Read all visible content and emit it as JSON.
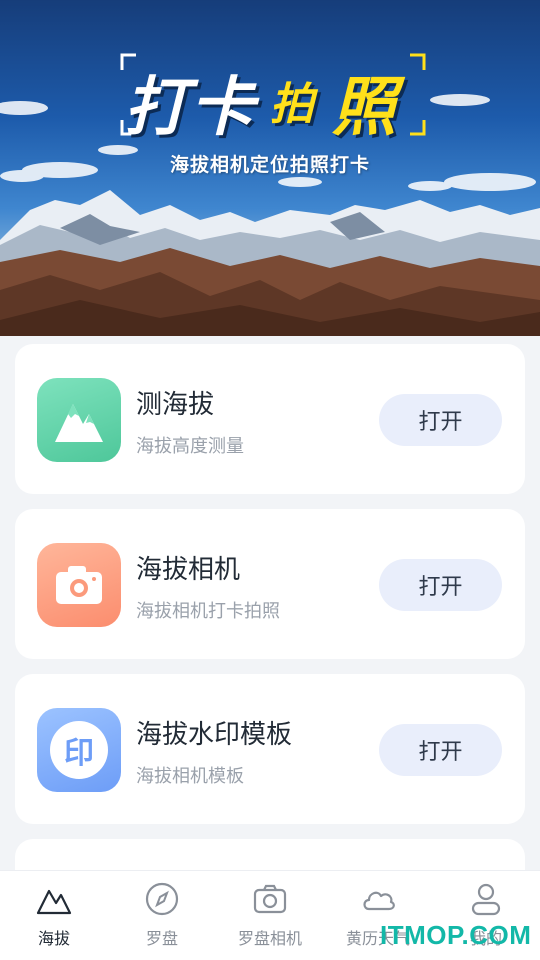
{
  "banner": {
    "title_part1": "打卡",
    "title_part2": "拍",
    "title_part3": "照",
    "subtitle": "海拔相机定位拍照打卡"
  },
  "cards": [
    {
      "title": "测海拔",
      "subtitle": "海拔高度测量",
      "button": "打开",
      "icon": "mountain-icon",
      "gradient": [
        "#7ee2bd",
        "#4ec79a"
      ]
    },
    {
      "title": "海拔相机",
      "subtitle": "海拔相机打卡拍照",
      "button": "打开",
      "icon": "camera-icon",
      "gradient": [
        "#ffb69a",
        "#fb8d6e"
      ]
    },
    {
      "title": "海拔水印模板",
      "subtitle": "海拔相机模板",
      "button": "打开",
      "icon": "stamp-icon",
      "stamp_text": "印",
      "gradient": [
        "#9cc3ff",
        "#6d9df7"
      ]
    }
  ],
  "tabbar": {
    "items": [
      {
        "label": "海拔",
        "icon": "mountain-outline-icon",
        "active": true
      },
      {
        "label": "罗盘",
        "icon": "compass-icon",
        "active": false
      },
      {
        "label": "罗盘相机",
        "icon": "camera-outline-icon",
        "active": false
      },
      {
        "label": "黄历天气",
        "icon": "cloud-icon",
        "active": false
      },
      {
        "label": "我的",
        "icon": "user-icon",
        "active": false
      }
    ]
  },
  "watermark": "ITMOP.COM",
  "colors": {
    "accent_yellow": "#ffe01a",
    "button_bg": "#e9eefb",
    "text_dark": "#222b36",
    "text_muted": "#9aa1ab"
  }
}
